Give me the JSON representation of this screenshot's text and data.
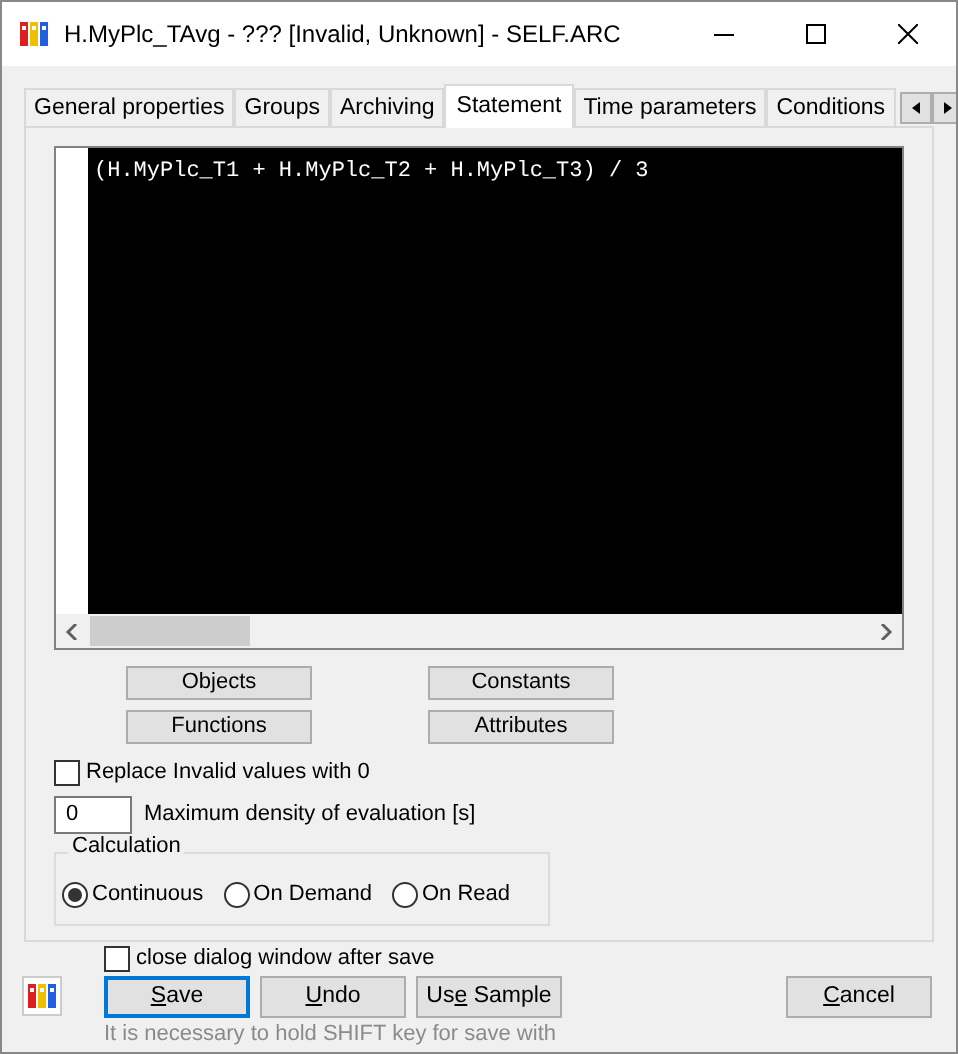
{
  "window": {
    "title": "H.MyPlc_TAvg - ??? [Invalid, Unknown] - SELF.ARC"
  },
  "tabs": [
    {
      "label": "General properties",
      "selected": false
    },
    {
      "label": "Groups",
      "selected": false
    },
    {
      "label": "Archiving",
      "selected": false
    },
    {
      "label": "Statement",
      "selected": true
    },
    {
      "label": "Time parameters",
      "selected": false
    },
    {
      "label": "Conditions",
      "selected": false
    }
  ],
  "statement": {
    "value": "(H.MyPlc_T1 + H.MyPlc_T2 + H.MyPlc_T3) / 3"
  },
  "insert_buttons": [
    [
      "Objects",
      "Constants"
    ],
    [
      "Functions",
      "Attributes"
    ]
  ],
  "replace_invalid": {
    "label": "Replace Invalid values with 0",
    "checked": false
  },
  "max_density": {
    "value": "0",
    "label": "Maximum density of evaluation [s]"
  },
  "calculation": {
    "title": "Calculation",
    "options": [
      {
        "label": "Continuous",
        "selected": true
      },
      {
        "label": "On Demand",
        "selected": false
      },
      {
        "label": "On Read",
        "selected": false
      }
    ]
  },
  "close_after_save": {
    "label": "close dialog window after save",
    "checked": false
  },
  "buttons": [
    {
      "label": {
        "access_key": "S",
        "after": "ave"
      },
      "focused": true
    },
    {
      "label": {
        "access_key": "U",
        "after": "ndo"
      },
      "focused": false
    },
    {
      "label": {
        "before": "Us",
        "access_key": "e",
        "after": " Sample"
      },
      "focused": false
    }
  ],
  "cancel": {
    "label": {
      "access_key": "C",
      "after": "ancel"
    }
  },
  "hint": "It is necessary to hold SHIFT key for save with"
}
